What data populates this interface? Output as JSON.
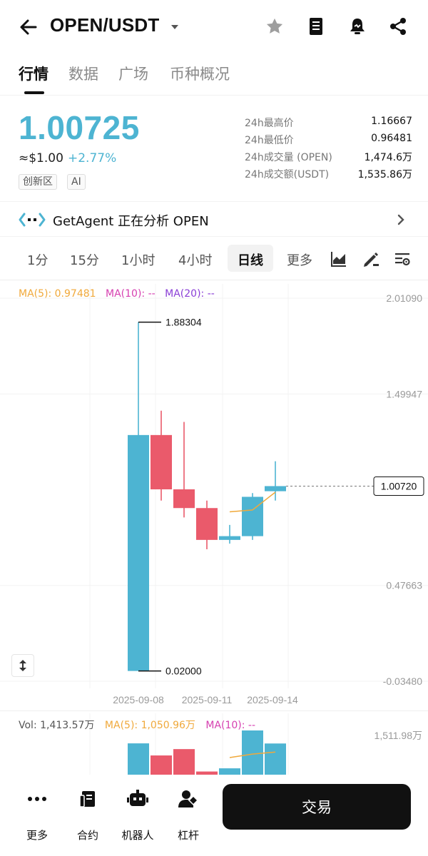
{
  "header": {
    "title": "OPEN/USDT",
    "icons": [
      "back-arrow-icon",
      "caret-down-icon",
      "star-icon",
      "book-icon",
      "price-alert-bell-icon",
      "share-icon"
    ]
  },
  "tabs": [
    {
      "label": "行情",
      "active": true
    },
    {
      "label": "数据",
      "active": false
    },
    {
      "label": "广场",
      "active": false
    },
    {
      "label": "币种概况",
      "active": false
    }
  ],
  "ticker": {
    "price": "1.00725",
    "usd": "≈$1.00",
    "change": "+2.77%",
    "badges": [
      "创新区",
      "AI"
    ],
    "accent_color": "#4db4d2"
  },
  "stats": [
    {
      "label": "24h最高价",
      "value": "1.16667"
    },
    {
      "label": "24h最低价",
      "value": "0.96481"
    },
    {
      "label": "24h成交量 (OPEN)",
      "value": "1,474.6万"
    },
    {
      "label": "24h成交额(USDT)",
      "value": "1,535.86万"
    }
  ],
  "agent": {
    "text": "GetAgent 正在分析 OPEN"
  },
  "intervals": [
    {
      "label": "1分",
      "active": false
    },
    {
      "label": "15分",
      "active": false
    },
    {
      "label": "1小时",
      "active": false
    },
    {
      "label": "4小时",
      "active": false
    },
    {
      "label": "日线",
      "active": true
    },
    {
      "label": "更多",
      "active": false
    }
  ],
  "ma": {
    "ma5": "MA(5): 0.97481",
    "ma10": "MA(10): --",
    "ma20": "MA(20): --",
    "colors": {
      "ma5": "#f0a93b",
      "ma10": "#d63fb0",
      "ma20": "#8a3ed6"
    }
  },
  "chart_data": {
    "type": "candlestick",
    "up_color": "#4db4d2",
    "down_color": "#ea5a6b",
    "y_ticks": [
      "2.01090",
      "1.49947",
      "0.47663",
      "-0.03480"
    ],
    "x_ticks": [
      "2025-09-08",
      "2025-09-11",
      "2025-09-14"
    ],
    "high_label": "1.88304",
    "low_label": "0.02000",
    "current_price_label": "1.00720",
    "candles": [
      {
        "open": 0.02,
        "close": 1.28,
        "high": 1.88304,
        "low": 0.02
      },
      {
        "open": 1.28,
        "close": 0.99,
        "high": 1.41,
        "low": 0.93
      },
      {
        "open": 0.99,
        "close": 0.89,
        "high": 1.35,
        "low": 0.84
      },
      {
        "open": 0.89,
        "close": 0.72,
        "high": 0.93,
        "low": 0.67
      },
      {
        "open": 0.72,
        "close": 0.74,
        "high": 0.8,
        "low": 0.7
      },
      {
        "open": 0.74,
        "close": 0.95,
        "high": 0.97,
        "low": 0.72
      },
      {
        "open": 0.98,
        "close": 1.00725,
        "high": 1.14,
        "low": 0.93
      }
    ],
    "ma5": [
      null,
      null,
      null,
      null,
      0.87,
      0.88,
      0.97481
    ]
  },
  "volume": {
    "vol": "Vol: 1,413.57万",
    "ma5": "MA(5): 1,050.96万",
    "ma10": "MA(10): --",
    "axis_label": "1,511.98万",
    "bars": [
      1207,
      741,
      986,
      122,
      245,
      1880,
      1202
    ],
    "bar_directions": [
      "up",
      "down",
      "down",
      "down",
      "up",
      "up",
      "up"
    ],
    "ma5_line": [
      null,
      null,
      null,
      null,
      660,
      795,
      872
    ]
  },
  "bottom_nav": [
    {
      "label": "更多",
      "icon": "more-dots-icon"
    },
    {
      "label": "合约",
      "icon": "contract-icon"
    },
    {
      "label": "机器人",
      "icon": "robot-icon"
    },
    {
      "label": "杠杆",
      "icon": "leverage-icon"
    }
  ],
  "trade_button": "交易"
}
